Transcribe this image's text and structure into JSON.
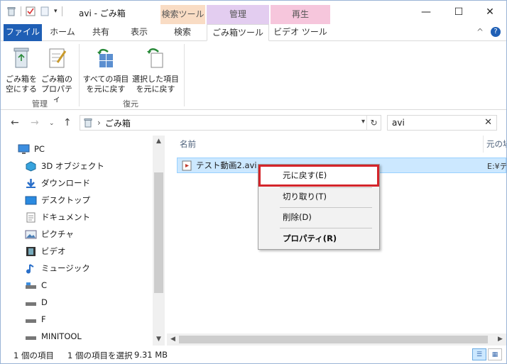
{
  "window": {
    "title": "avi - ごみ箱",
    "context_tabs": [
      "検索ツール",
      "管理",
      "再生"
    ],
    "controls": {
      "minimize": "—",
      "maximize": "☐",
      "close": "✕"
    }
  },
  "ribbon_tabs": {
    "file": "ファイル",
    "home": "ホーム",
    "share": "共有",
    "view": "表示",
    "search": "検索",
    "recycle_tools": "ごみ箱ツール",
    "video_tools": "ビデオ ツール",
    "collapse": "^",
    "help": "?"
  },
  "ribbon": {
    "empty_bin": [
      "ごみ箱を",
      "空にする"
    ],
    "bin_props": [
      "ごみ箱の",
      "プロパティ"
    ],
    "restore_all": [
      "すべての項目",
      "を元に戻す"
    ],
    "restore_selected": [
      "選択した項目",
      "を元に戻す"
    ],
    "group_manage": "管理",
    "group_restore": "復元"
  },
  "address": {
    "path_root": "›",
    "path": "ごみ箱",
    "search_value": "avi"
  },
  "nav": {
    "items": [
      "PC",
      "3D オブジェクト",
      "ダウンロード",
      "デスクトップ",
      "ドキュメント",
      "ピクチャ",
      "ビデオ",
      "ミュージック",
      "C",
      "D",
      "F",
      "MINITOOL"
    ]
  },
  "content": {
    "col_name": "名前",
    "col_location": "元の場",
    "file_name": "テスト動画2.avi",
    "file_location": "E:¥テ"
  },
  "context_menu": {
    "restore": "元に戻す(E)",
    "cut": "切り取り(T)",
    "delete": "削除(D)",
    "properties": "プロパティ(R)"
  },
  "status": {
    "count": "1 個の項目",
    "selected": "1 個の項目を選択",
    "size": "9.31 MB"
  },
  "colors": {
    "file_tab": "#1f5fb5",
    "selection": "#cce8ff",
    "highlight_border": "#d4252b"
  }
}
